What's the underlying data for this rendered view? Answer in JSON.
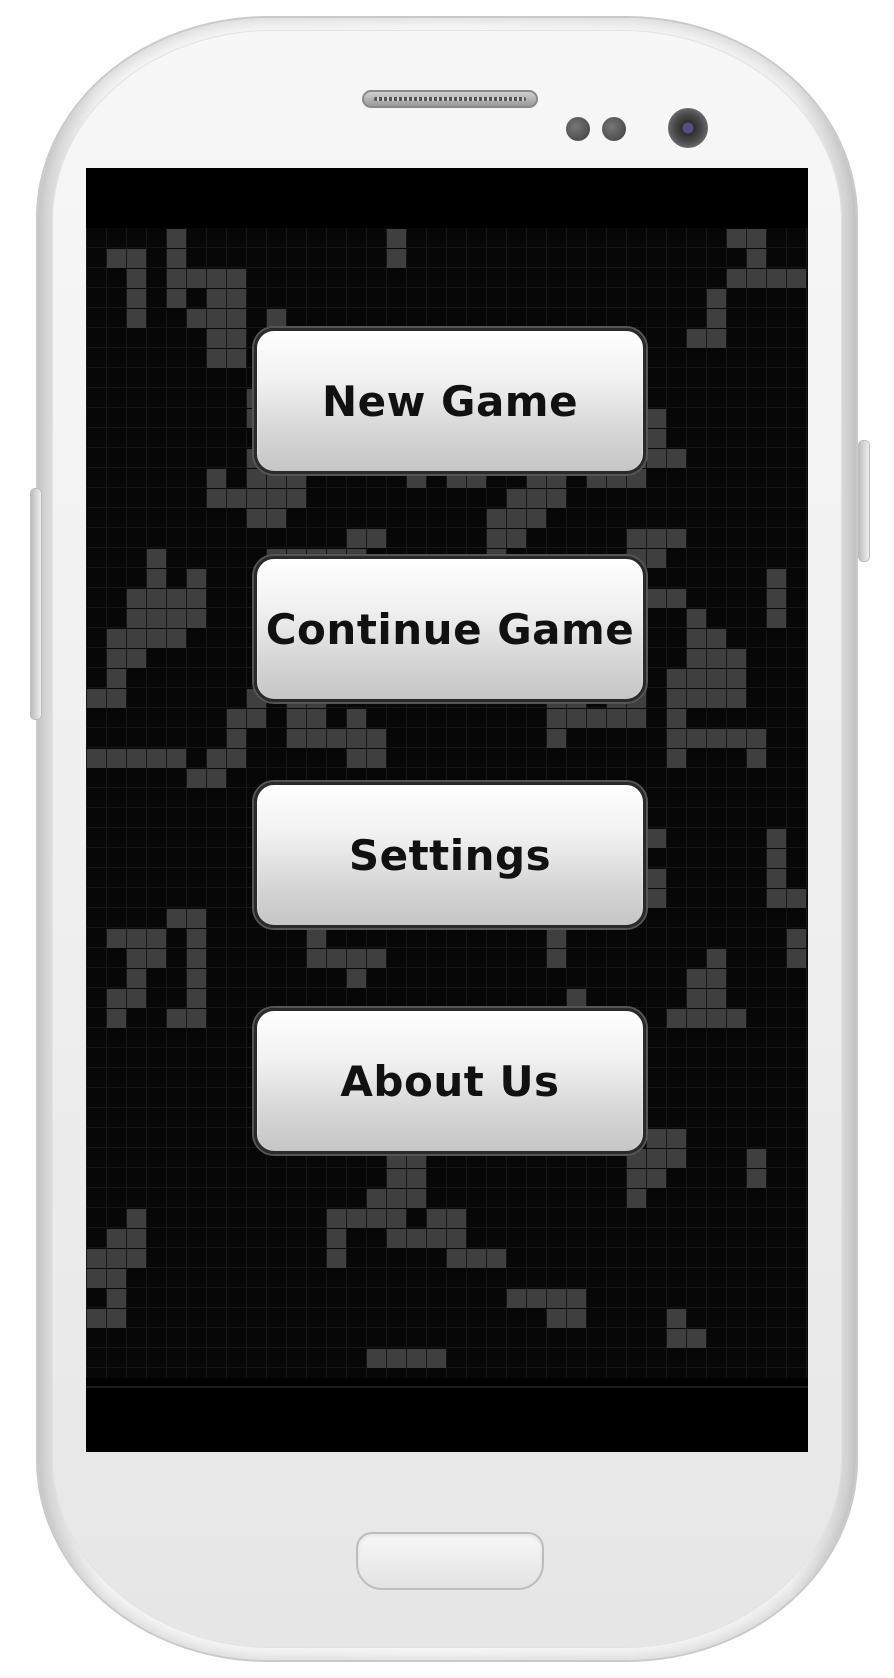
{
  "app": {
    "menu": [
      {
        "id": "new-game",
        "label": "New Game"
      },
      {
        "id": "continue-game",
        "label": "Continue Game"
      },
      {
        "id": "settings",
        "label": "Settings"
      },
      {
        "id": "about-us",
        "label": "About Us"
      }
    ]
  },
  "colors": {
    "screen_background": "#000000",
    "live_cell": "#3f3f3f",
    "grid_line": "#161616",
    "button_text": "#111111"
  }
}
